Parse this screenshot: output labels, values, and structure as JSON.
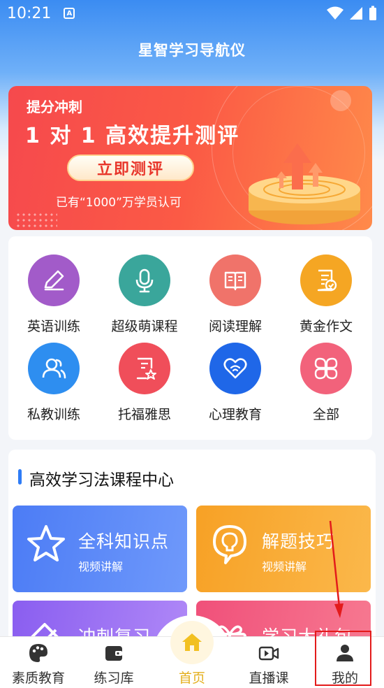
{
  "status_bar": {
    "time": "10:21",
    "a_badge": "A"
  },
  "header": {
    "title": "星智学习导航仪"
  },
  "banner": {
    "tag": "提分冲刺",
    "heading": "1 对 1 高效提升测评",
    "button_label": "立即测评",
    "subtext": "已有“1000”万学员认可"
  },
  "grid": {
    "items": [
      {
        "label": "英语训练",
        "icon": "pencil-icon",
        "color": "#a25bc9"
      },
      {
        "label": "超级萌课程",
        "icon": "microphone-icon",
        "color": "#3aa69b"
      },
      {
        "label": "阅读理解",
        "icon": "book-icon",
        "color": "#f0736a"
      },
      {
        "label": "黄金作文",
        "icon": "document-check-icon",
        "color": "#f5a623"
      },
      {
        "label": "私教训练",
        "icon": "users-icon",
        "color": "#2e8ef0"
      },
      {
        "label": "托福雅思",
        "icon": "certificate-icon",
        "color": "#f04e5a"
      },
      {
        "label": "心理教育",
        "icon": "heart-icon",
        "color": "#1f67e8"
      },
      {
        "label": "全部",
        "icon": "clover-grid-icon",
        "color": "#f2627b"
      }
    ]
  },
  "courses": {
    "title": "高效学习法课程中心",
    "cards": [
      {
        "title": "全科知识点",
        "subtitle": "视频讲解",
        "icon": "star-icon",
        "color_from": "#4c7cf5",
        "color_to": "#6f99fb"
      },
      {
        "title": "解题技巧",
        "subtitle": "视频讲解",
        "icon": "lightbulb-icon",
        "color_from": "#f7a125",
        "color_to": "#fbb84b"
      },
      {
        "title": "冲刺复习",
        "subtitle": "",
        "icon": "pencil-ruler-icon",
        "color_from": "#8a5ef0",
        "color_to": "#b089f7"
      },
      {
        "title": "学习大礼包",
        "subtitle": "",
        "icon": "gift-icon",
        "color_from": "#f0507a",
        "color_to": "#f77a91"
      }
    ]
  },
  "tabbar": {
    "tabs": [
      {
        "label": "素质教育",
        "icon": "palette-icon"
      },
      {
        "label": "练习库",
        "icon": "wallet-icon"
      },
      {
        "label": "首页",
        "icon": "home-icon",
        "active": true,
        "active_color": "#e4b020"
      },
      {
        "label": "直播课",
        "icon": "video-icon"
      },
      {
        "label": "我的",
        "icon": "person-icon"
      }
    ]
  }
}
